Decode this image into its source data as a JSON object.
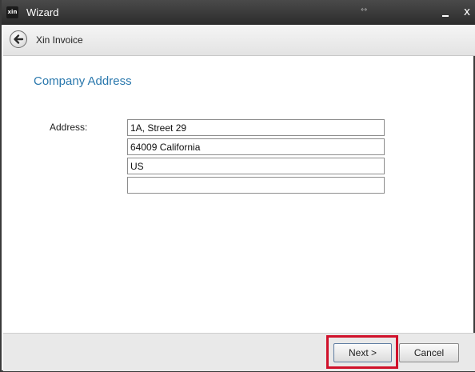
{
  "window": {
    "title": "Wizard",
    "logo_text": "xin",
    "grip": "↔",
    "close": "x"
  },
  "navbar": {
    "app_name": "Xin Invoice"
  },
  "page": {
    "heading": "Company Address",
    "address_label": "Address:",
    "address_lines": [
      "1A, Street 29",
      "64009 California",
      "US",
      ""
    ]
  },
  "footer": {
    "next_label": "Next >",
    "cancel_label": "Cancel"
  },
  "colors": {
    "heading": "#2a78ad",
    "highlight": "#d0112b",
    "titlebar": "#2c2c2c"
  },
  "icons": {
    "back": "back-arrow-icon",
    "minimize": "minimize-icon",
    "close": "close-icon"
  }
}
